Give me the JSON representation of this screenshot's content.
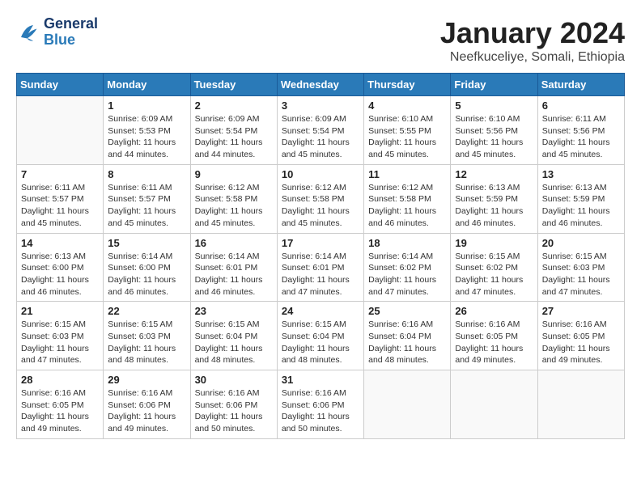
{
  "header": {
    "logo_line1": "General",
    "logo_line2": "Blue",
    "month": "January 2024",
    "location": "Neefkuceliye, Somali, Ethiopia"
  },
  "days_of_week": [
    "Sunday",
    "Monday",
    "Tuesday",
    "Wednesday",
    "Thursday",
    "Friday",
    "Saturday"
  ],
  "weeks": [
    [
      {
        "day": "",
        "info": ""
      },
      {
        "day": "1",
        "info": "Sunrise: 6:09 AM\nSunset: 5:53 PM\nDaylight: 11 hours\nand 44 minutes."
      },
      {
        "day": "2",
        "info": "Sunrise: 6:09 AM\nSunset: 5:54 PM\nDaylight: 11 hours\nand 44 minutes."
      },
      {
        "day": "3",
        "info": "Sunrise: 6:09 AM\nSunset: 5:54 PM\nDaylight: 11 hours\nand 45 minutes."
      },
      {
        "day": "4",
        "info": "Sunrise: 6:10 AM\nSunset: 5:55 PM\nDaylight: 11 hours\nand 45 minutes."
      },
      {
        "day": "5",
        "info": "Sunrise: 6:10 AM\nSunset: 5:56 PM\nDaylight: 11 hours\nand 45 minutes."
      },
      {
        "day": "6",
        "info": "Sunrise: 6:11 AM\nSunset: 5:56 PM\nDaylight: 11 hours\nand 45 minutes."
      }
    ],
    [
      {
        "day": "7",
        "info": "Sunrise: 6:11 AM\nSunset: 5:57 PM\nDaylight: 11 hours\nand 45 minutes."
      },
      {
        "day": "8",
        "info": "Sunrise: 6:11 AM\nSunset: 5:57 PM\nDaylight: 11 hours\nand 45 minutes."
      },
      {
        "day": "9",
        "info": "Sunrise: 6:12 AM\nSunset: 5:58 PM\nDaylight: 11 hours\nand 45 minutes."
      },
      {
        "day": "10",
        "info": "Sunrise: 6:12 AM\nSunset: 5:58 PM\nDaylight: 11 hours\nand 45 minutes."
      },
      {
        "day": "11",
        "info": "Sunrise: 6:12 AM\nSunset: 5:58 PM\nDaylight: 11 hours\nand 46 minutes."
      },
      {
        "day": "12",
        "info": "Sunrise: 6:13 AM\nSunset: 5:59 PM\nDaylight: 11 hours\nand 46 minutes."
      },
      {
        "day": "13",
        "info": "Sunrise: 6:13 AM\nSunset: 5:59 PM\nDaylight: 11 hours\nand 46 minutes."
      }
    ],
    [
      {
        "day": "14",
        "info": "Sunrise: 6:13 AM\nSunset: 6:00 PM\nDaylight: 11 hours\nand 46 minutes."
      },
      {
        "day": "15",
        "info": "Sunrise: 6:14 AM\nSunset: 6:00 PM\nDaylight: 11 hours\nand 46 minutes."
      },
      {
        "day": "16",
        "info": "Sunrise: 6:14 AM\nSunset: 6:01 PM\nDaylight: 11 hours\nand 46 minutes."
      },
      {
        "day": "17",
        "info": "Sunrise: 6:14 AM\nSunset: 6:01 PM\nDaylight: 11 hours\nand 47 minutes."
      },
      {
        "day": "18",
        "info": "Sunrise: 6:14 AM\nSunset: 6:02 PM\nDaylight: 11 hours\nand 47 minutes."
      },
      {
        "day": "19",
        "info": "Sunrise: 6:15 AM\nSunset: 6:02 PM\nDaylight: 11 hours\nand 47 minutes."
      },
      {
        "day": "20",
        "info": "Sunrise: 6:15 AM\nSunset: 6:03 PM\nDaylight: 11 hours\nand 47 minutes."
      }
    ],
    [
      {
        "day": "21",
        "info": "Sunrise: 6:15 AM\nSunset: 6:03 PM\nDaylight: 11 hours\nand 47 minutes."
      },
      {
        "day": "22",
        "info": "Sunrise: 6:15 AM\nSunset: 6:03 PM\nDaylight: 11 hours\nand 48 minutes."
      },
      {
        "day": "23",
        "info": "Sunrise: 6:15 AM\nSunset: 6:04 PM\nDaylight: 11 hours\nand 48 minutes."
      },
      {
        "day": "24",
        "info": "Sunrise: 6:15 AM\nSunset: 6:04 PM\nDaylight: 11 hours\nand 48 minutes."
      },
      {
        "day": "25",
        "info": "Sunrise: 6:16 AM\nSunset: 6:04 PM\nDaylight: 11 hours\nand 48 minutes."
      },
      {
        "day": "26",
        "info": "Sunrise: 6:16 AM\nSunset: 6:05 PM\nDaylight: 11 hours\nand 49 minutes."
      },
      {
        "day": "27",
        "info": "Sunrise: 6:16 AM\nSunset: 6:05 PM\nDaylight: 11 hours\nand 49 minutes."
      }
    ],
    [
      {
        "day": "28",
        "info": "Sunrise: 6:16 AM\nSunset: 6:05 PM\nDaylight: 11 hours\nand 49 minutes."
      },
      {
        "day": "29",
        "info": "Sunrise: 6:16 AM\nSunset: 6:06 PM\nDaylight: 11 hours\nand 49 minutes."
      },
      {
        "day": "30",
        "info": "Sunrise: 6:16 AM\nSunset: 6:06 PM\nDaylight: 11 hours\nand 50 minutes."
      },
      {
        "day": "31",
        "info": "Sunrise: 6:16 AM\nSunset: 6:06 PM\nDaylight: 11 hours\nand 50 minutes."
      },
      {
        "day": "",
        "info": ""
      },
      {
        "day": "",
        "info": ""
      },
      {
        "day": "",
        "info": ""
      }
    ]
  ]
}
